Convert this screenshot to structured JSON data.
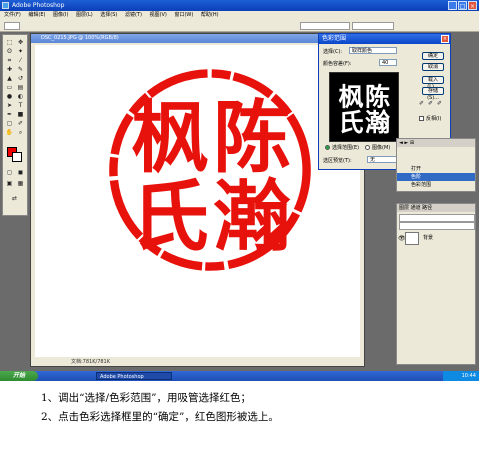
{
  "app": {
    "window_title": "Adobe Photoshop",
    "menus": [
      "文件(F)",
      "编辑(E)",
      "图像(I)",
      "图层(L)",
      "选择(S)",
      "滤镜(T)",
      "视图(V)",
      "窗口(W)",
      "帮助(H)"
    ],
    "document_title": "DSC_0215.JPG @ 100%(RGB/8)",
    "status_zoom": "文档:781K/781K"
  },
  "seal": {
    "characters": [
      "陈",
      "瀚",
      "枫",
      "氏"
    ],
    "color": "#e8120c"
  },
  "dialog": {
    "title": "色彩范围",
    "select_label": "选择(C):",
    "select_value": "取样颜色",
    "fuzziness_label": "颜色容差(F):",
    "fuzziness_value": "40",
    "buttons": [
      "确定",
      "取消",
      "载入(L)...",
      "存储(S)..."
    ],
    "invert_label": "反相(I)",
    "radio_selection": "选择范围(E)",
    "radio_image": "图像(M)",
    "selection_preview_label": "选区预览(T):",
    "selection_preview_value": "无"
  },
  "layers_panel": {
    "tabs": "图层 通道 路径",
    "layer_name": "背景"
  },
  "history_panel": {
    "rows": [
      "打开",
      "色阶",
      "色彩范围"
    ]
  },
  "taskbar": {
    "start": "开始",
    "item": "Adobe Photoshop",
    "clock": "10:44"
  },
  "captions": [
    "1、调出“选择/色彩范围”，用吸管选择红色；",
    "2、点击色彩选择框里的“确定”，红色图形被选上。"
  ]
}
